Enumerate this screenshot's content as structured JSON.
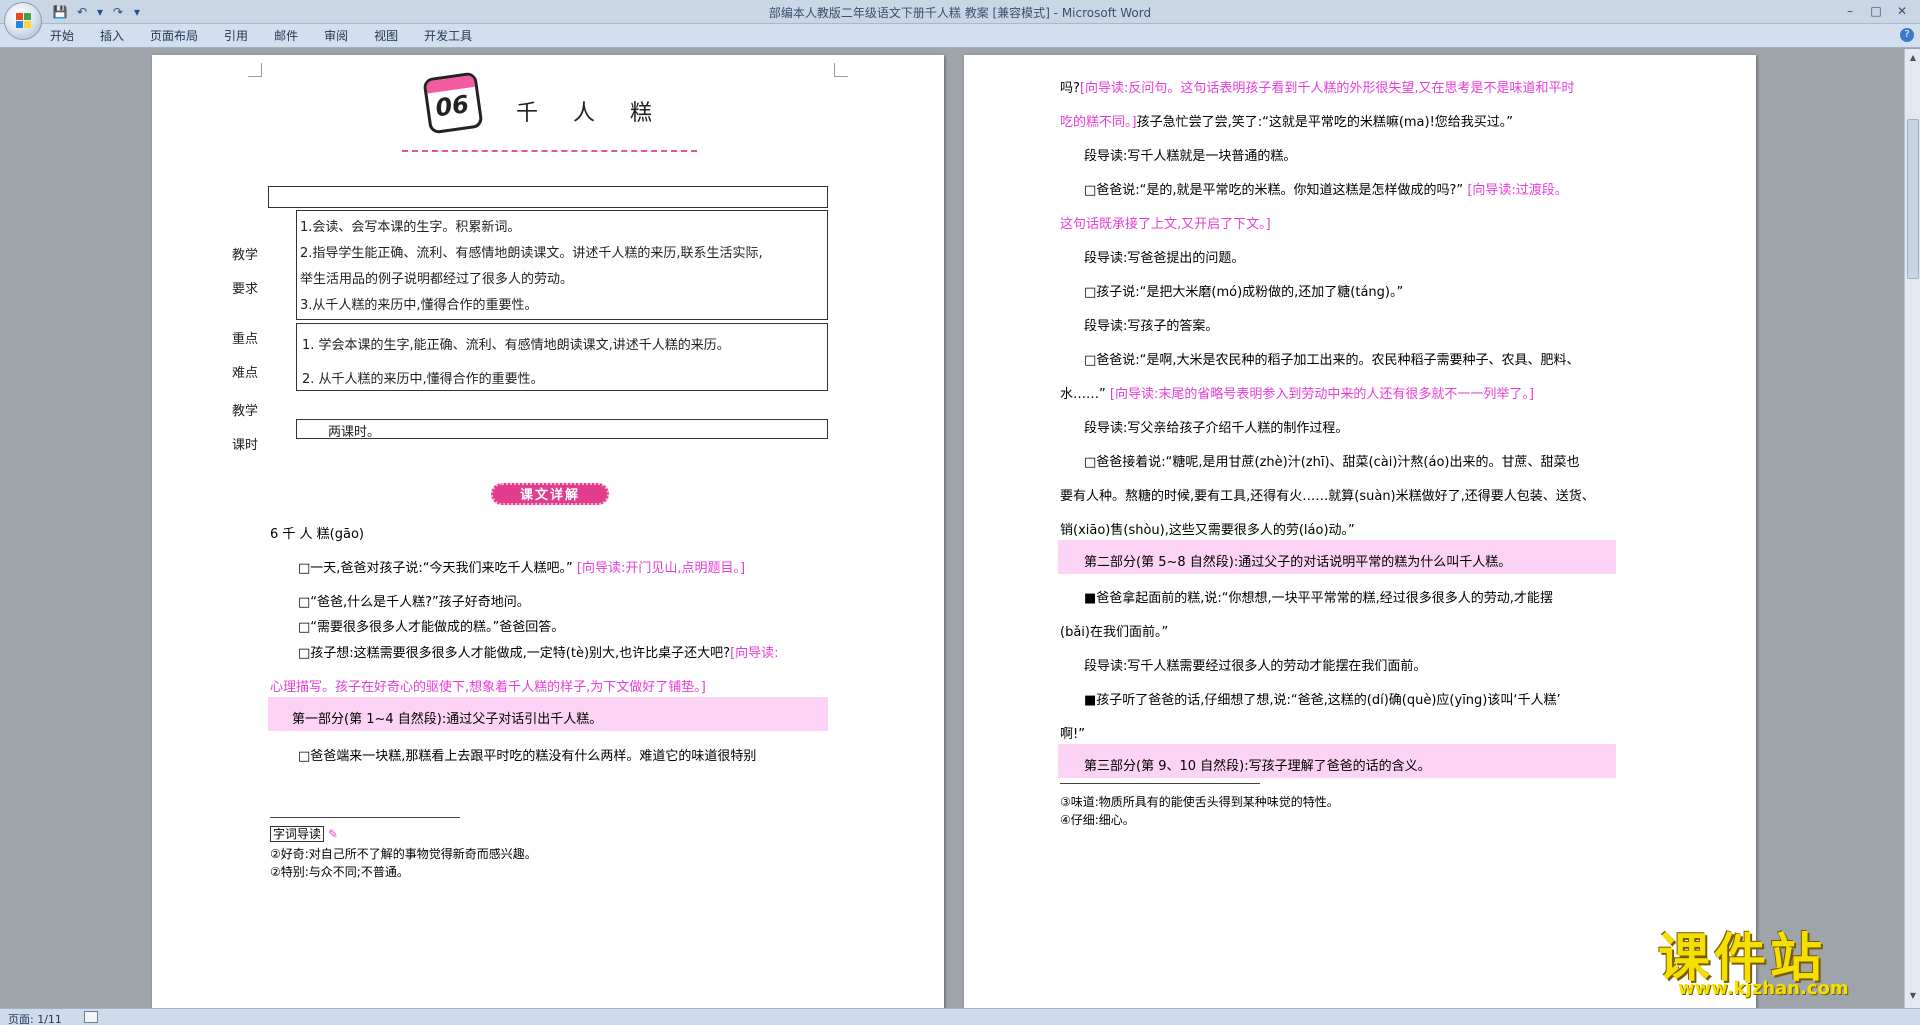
{
  "window": {
    "title": "部编本人教版二年级语文下册千人糕 教案 [兼容模式] - Microsoft Word"
  },
  "ribbon": {
    "tabs": [
      "开始",
      "插入",
      "页面布局",
      "引用",
      "邮件",
      "审阅",
      "视图",
      "开发工具"
    ]
  },
  "status": {
    "page": "页面: 1/11"
  },
  "left_page": {
    "lesson_number": "06",
    "lesson_title": "千 人 糕",
    "table": {
      "req_label_1": "教学",
      "req_label_2": "要求",
      "req_items": [
        "1.会读、会写本课的生字。积累新词。",
        "2.指导学生能正确、流利、有感情地朗读课文。讲述千人糕的来历,联系生活实际,",
        "举生活用品的例子说明都经过了很多人的劳动。",
        "3.从千人糕的来历中,懂得合作的重要性。"
      ],
      "key_label_1": "重点",
      "key_label_2": "难点",
      "key_items": [
        "1. 学会本课的生字,能正确、流利、有感情地朗读课文,讲述千人糕的来历。",
        "2. 从千人糕的来历中,懂得合作的重要性。"
      ],
      "time_label_1": "教学",
      "time_label_2": "课时",
      "time_value": "两课时。"
    },
    "banner": "课文详解",
    "text_heading": "6 千 人 糕(gāo)",
    "paras": [
      {
        "text": "□一天,爸爸对孩子说:“今天我们来吃千人糕吧。”",
        "note": "[向导读:开门见山,点明题目。]"
      },
      {
        "text": "□“爸爸,什么是千人糕?”孩子好奇地问。",
        "note": ""
      },
      {
        "text": "□“需要很多很多人才能做成的糕。”爸爸回答。",
        "note": ""
      },
      {
        "text": "□孩子想:这糕需要很多很多人才能做成,一定特(tè)别大,也许比桌子还大吧?",
        "note": "[向导读:"
      },
      {
        "text": "",
        "note": "心理描写。孩子在好奇心的驱使下,想象着千人糕的样子,为下文做好了铺垫。]"
      }
    ],
    "section_1": "第一部分(第 1~4 自然段):通过父子对话引出千人糕。",
    "para_after": "□爸爸端来一块糕,那糕看上去跟平时吃的糕没有什么两样。难道它的味道很特别",
    "footnotes": [
      "字词导读",
      "②好奇:对自己所不了解的事物觉得新奇而感兴趣。",
      "②特别:与众不同;不普通。"
    ]
  },
  "right_page": {
    "lines": [
      {
        "text": "吗?",
        "note": "[向导读:反问句。这句话表明孩子看到千人糕的外形很失望,又在思考是不是味道和平时",
        "tail": ""
      },
      {
        "text": "",
        "note": "吃的糕不同。]",
        "tail": "孩子急忙尝了尝,笑了:“这就是平常吃的米糕嘛(ma)!您给我买过。”"
      },
      {
        "text": "段导读:写千人糕就是一块普通的糕。",
        "note": "",
        "tail": ""
      },
      {
        "text": "□爸爸说:“是的,就是平常吃的米糕。你知道这糕是怎样做成的吗?”",
        "note": "[向导读:过渡段。",
        "tail": ""
      },
      {
        "text": "",
        "note": "这句话既承接了上文,又开启了下文。]",
        "tail": ""
      },
      {
        "text": "段导读:写爸爸提出的问题。",
        "note": "",
        "tail": ""
      },
      {
        "text": "□孩子说:“是把大米磨(mó)成粉做的,还加了糖(táng)。”",
        "note": "",
        "tail": ""
      },
      {
        "text": "段导读:写孩子的答案。",
        "note": "",
        "tail": ""
      },
      {
        "text": "□爸爸说:“是啊,大米是农民种的稻子加工出来的。农民种稻子需要种子、农具、肥料、",
        "note": "",
        "tail": ""
      },
      {
        "text": "水……”",
        "note": "[向导读:末尾的省略号表明参入到劳动中来的人还有很多就不一一列举了。]",
        "tail": ""
      },
      {
        "text": "段导读:写父亲给孩子介绍千人糕的制作过程。",
        "note": "",
        "tail": ""
      },
      {
        "text": "□爸爸接着说:“糖呢,是用甘蔗(zhè)汁(zhī)、甜菜(cài)汁熬(áo)出来的。甘蔗、甜菜也",
        "note": "",
        "tail": ""
      },
      {
        "text": "要有人种。熬糖的时候,要有工具,还得有火……就算(suàn)米糕做好了,还得要人包装、送货、",
        "note": "",
        "tail": ""
      },
      {
        "text": "销(xiāo)售(shòu),这些又需要很多人的劳(láo)动。”",
        "note": "",
        "tail": ""
      }
    ],
    "section_2": "第二部分(第 5~8 自然段):通过父子的对话说明平常的糕为什么叫千人糕。",
    "lines2": [
      "■爸爸拿起面前的糕,说:“你想想,一块平平常常的糕,经过很多很多人的劳动,才能摆",
      "(bǎi)在我们面前。”",
      "段导读:写千人糕需要经过很多人的劳动才能摆在我们面前。",
      "■孩子听了爸爸的话,仔细想了想,说:“爸爸,这糕的(dí)确(què)应(yīng)该叫‘千人糕’",
      "啊!”"
    ],
    "section_3": "第三部分(第 9、10 自然段):写孩子理解了爸爸的话的含义。",
    "footnotes": [
      "③味道:物质所具有的能使舌头得到某种味觉的特性。",
      "④仔细:细心。"
    ]
  },
  "watermark": {
    "brand": "课件站",
    "url": "www.kjzhan.com"
  },
  "colors": {
    "pink_note": "#e83cd8",
    "section_band": "#fdd3f5",
    "banner": "#e23c8c",
    "ribbon": "#d3dfee"
  }
}
